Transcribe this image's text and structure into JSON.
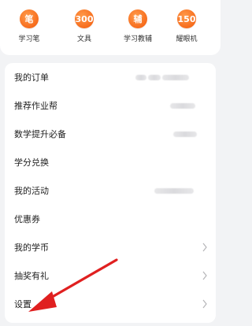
{
  "shortcuts": [
    {
      "label": "学习笔",
      "icon_text": "笔",
      "icon": "pen-icon"
    },
    {
      "label": "文具",
      "icon_text": "300",
      "icon": "stationery-icon"
    },
    {
      "label": "学习教辅",
      "icon_text": "辅",
      "icon": "tutoring-book-icon"
    },
    {
      "label": "耀眼机",
      "icon_text": "150",
      "icon": "device-icon"
    }
  ],
  "menu": {
    "items": [
      {
        "label": "我的订单"
      },
      {
        "label": "推荐作业帮"
      },
      {
        "label": "数学提升必备"
      },
      {
        "label": "学分兑换"
      },
      {
        "label": "我的活动"
      },
      {
        "label": "优惠券"
      },
      {
        "label": "我的学币"
      },
      {
        "label": "抽奖有礼"
      },
      {
        "label": "设置"
      }
    ]
  },
  "colors": {
    "accent_orange": "#f76d1d",
    "annotation_red": "#e02020",
    "background": "#f2f3f5"
  }
}
